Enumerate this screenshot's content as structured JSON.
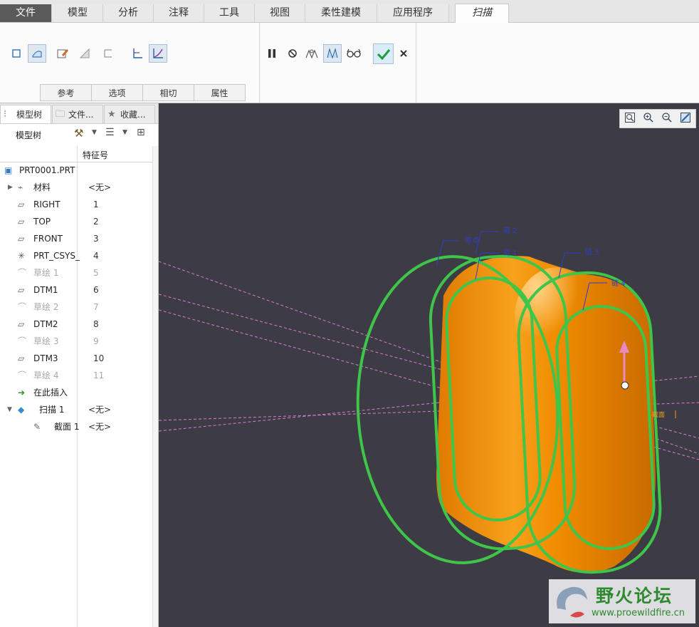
{
  "ribbon": {
    "tabs": [
      "文件",
      "模型",
      "分析",
      "注释",
      "工具",
      "视图",
      "柔性建模",
      "应用程序",
      "扫描"
    ],
    "active_tab": "扫描",
    "group_tabs": [
      "参考",
      "选项",
      "相切",
      "属性"
    ]
  },
  "left_panel": {
    "tabs": [
      "模型树",
      "文件...",
      "收藏..."
    ],
    "toolbar_label": "模型树",
    "column_header": "特征号",
    "root": "PRT0001.PRT",
    "rows": [
      {
        "name": "材料",
        "num": "<无>",
        "icon": "material-icon",
        "dim": false
      },
      {
        "name": "RIGHT",
        "num": "1",
        "icon": "datum-plane-icon",
        "dim": false
      },
      {
        "name": "TOP",
        "num": "2",
        "icon": "datum-plane-icon",
        "dim": false
      },
      {
        "name": "FRONT",
        "num": "3",
        "icon": "datum-plane-icon",
        "dim": false
      },
      {
        "name": "PRT_CSYS_",
        "num": "4",
        "icon": "csys-icon",
        "dim": false
      },
      {
        "name": "草绘 1",
        "num": "5",
        "icon": "sketch-icon",
        "dim": true
      },
      {
        "name": "DTM1",
        "num": "6",
        "icon": "datum-plane-icon",
        "dim": false
      },
      {
        "name": "草绘 2",
        "num": "7",
        "icon": "sketch-icon",
        "dim": true
      },
      {
        "name": "DTM2",
        "num": "8",
        "icon": "datum-plane-icon",
        "dim": false
      },
      {
        "name": "草绘 3",
        "num": "9",
        "icon": "sketch-icon",
        "dim": true
      },
      {
        "name": "DTM3",
        "num": "10",
        "icon": "datum-plane-icon",
        "dim": false
      },
      {
        "name": "草绘 4",
        "num": "11",
        "icon": "sketch-icon",
        "dim": true
      },
      {
        "name": "在此插入",
        "num": "",
        "icon": "insert-arrow-icon",
        "dim": false
      },
      {
        "name": "扫描 1",
        "num": "<无>",
        "icon": "sweep-icon",
        "dim": false
      },
      {
        "name": "截面 1",
        "num": "<无>",
        "icon": "section-icon",
        "dim": false
      }
    ]
  },
  "viewport": {
    "labels": {
      "origin": "原点",
      "chain1": "链 1",
      "chain2": "链 2",
      "chain3": "链 3",
      "chain4": "链 4",
      "section": "截面"
    },
    "colors": {
      "background": "#3d3c44",
      "body": "#f28c00",
      "chain": "#3fc54a",
      "datum": "#d87ad8"
    }
  },
  "watermark": {
    "title": "野火论坛",
    "url": "www.proewildfire.cn"
  }
}
